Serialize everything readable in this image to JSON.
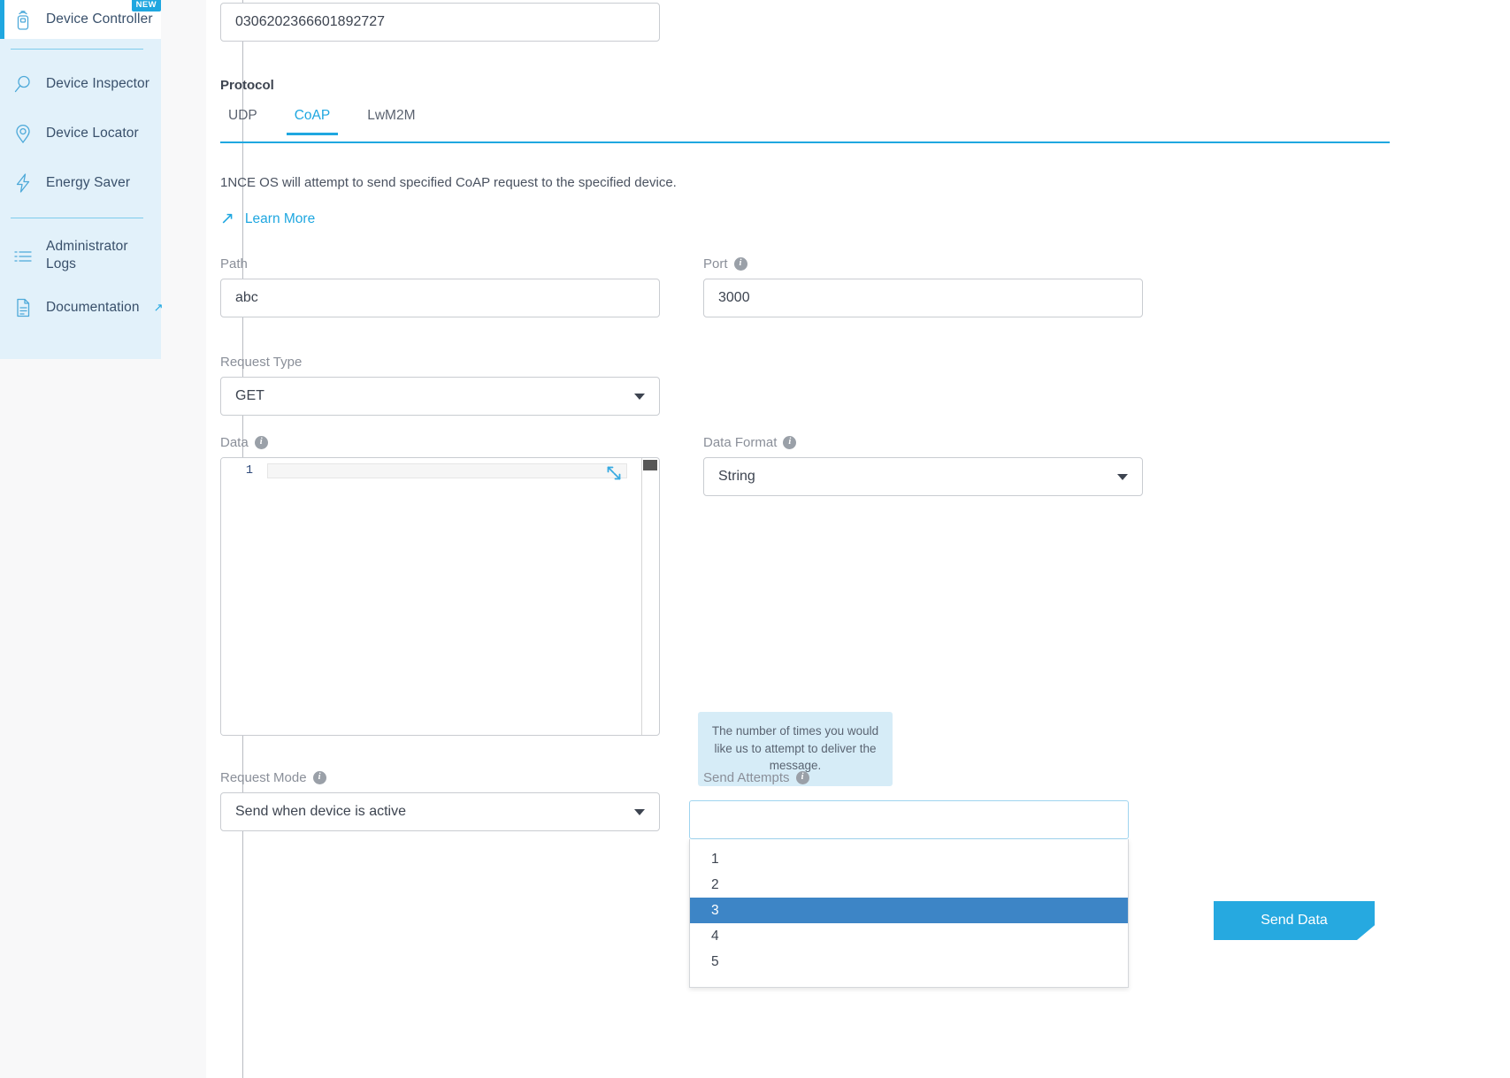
{
  "sidebar": {
    "items": [
      {
        "label": "Device Controller",
        "icon": "device-remote-icon",
        "badge": "NEW",
        "active": true
      },
      {
        "label": "Device Inspector",
        "icon": "magnifier-icon"
      },
      {
        "label": "Device Locator",
        "icon": "map-pin-icon"
      },
      {
        "label": "Energy Saver",
        "icon": "lightning-bolt-icon"
      },
      {
        "label": "Administrator Logs",
        "icon": "list-lines-icon"
      },
      {
        "label": "Documentation",
        "icon": "document-icon",
        "external": "↗"
      }
    ]
  },
  "form": {
    "iccid": {
      "value": "0306202366601892727",
      "placeholder": ""
    },
    "protocol": {
      "title": "Protocol",
      "tabs": [
        {
          "label": "UDP",
          "active": false
        },
        {
          "label": "CoAP",
          "active": true
        },
        {
          "label": "LwM2M",
          "active": false
        }
      ]
    },
    "description": "1NCE OS will attempt to send specified CoAP request to the specified device.",
    "learn_more": "Learn More",
    "path": {
      "label": "Path",
      "value": "abc",
      "placeholder": ""
    },
    "port": {
      "label": "Port",
      "value": "3000",
      "placeholder": "",
      "has_info": true
    },
    "request_type": {
      "label": "Request Type",
      "value": "GET"
    },
    "data": {
      "label": "Data",
      "has_info": true,
      "line_number": "1",
      "value": ""
    },
    "data_format": {
      "label": "Data Format",
      "value": "String",
      "has_info": true
    },
    "request_mode": {
      "label": "Request Mode",
      "value": "Send when device is active",
      "has_info": true
    },
    "send_attempts": {
      "label": "Send Attempts",
      "has_info": true,
      "value": "",
      "tooltip": "The number of times you would like us to attempt to deliver the message.",
      "options": [
        {
          "label": "1",
          "selected": false
        },
        {
          "label": "2",
          "selected": false
        },
        {
          "label": "3",
          "selected": true
        },
        {
          "label": "4",
          "selected": false
        },
        {
          "label": "5",
          "selected": false
        }
      ]
    },
    "actions": {
      "cancel_label": "",
      "submit_label": "Send Data"
    }
  },
  "colors": {
    "accent": "#1fa7e0",
    "sidebar_bg": "#e2f1fa",
    "selected_option": "#3d85c6",
    "tooltip_bg": "#d6ecf7"
  }
}
